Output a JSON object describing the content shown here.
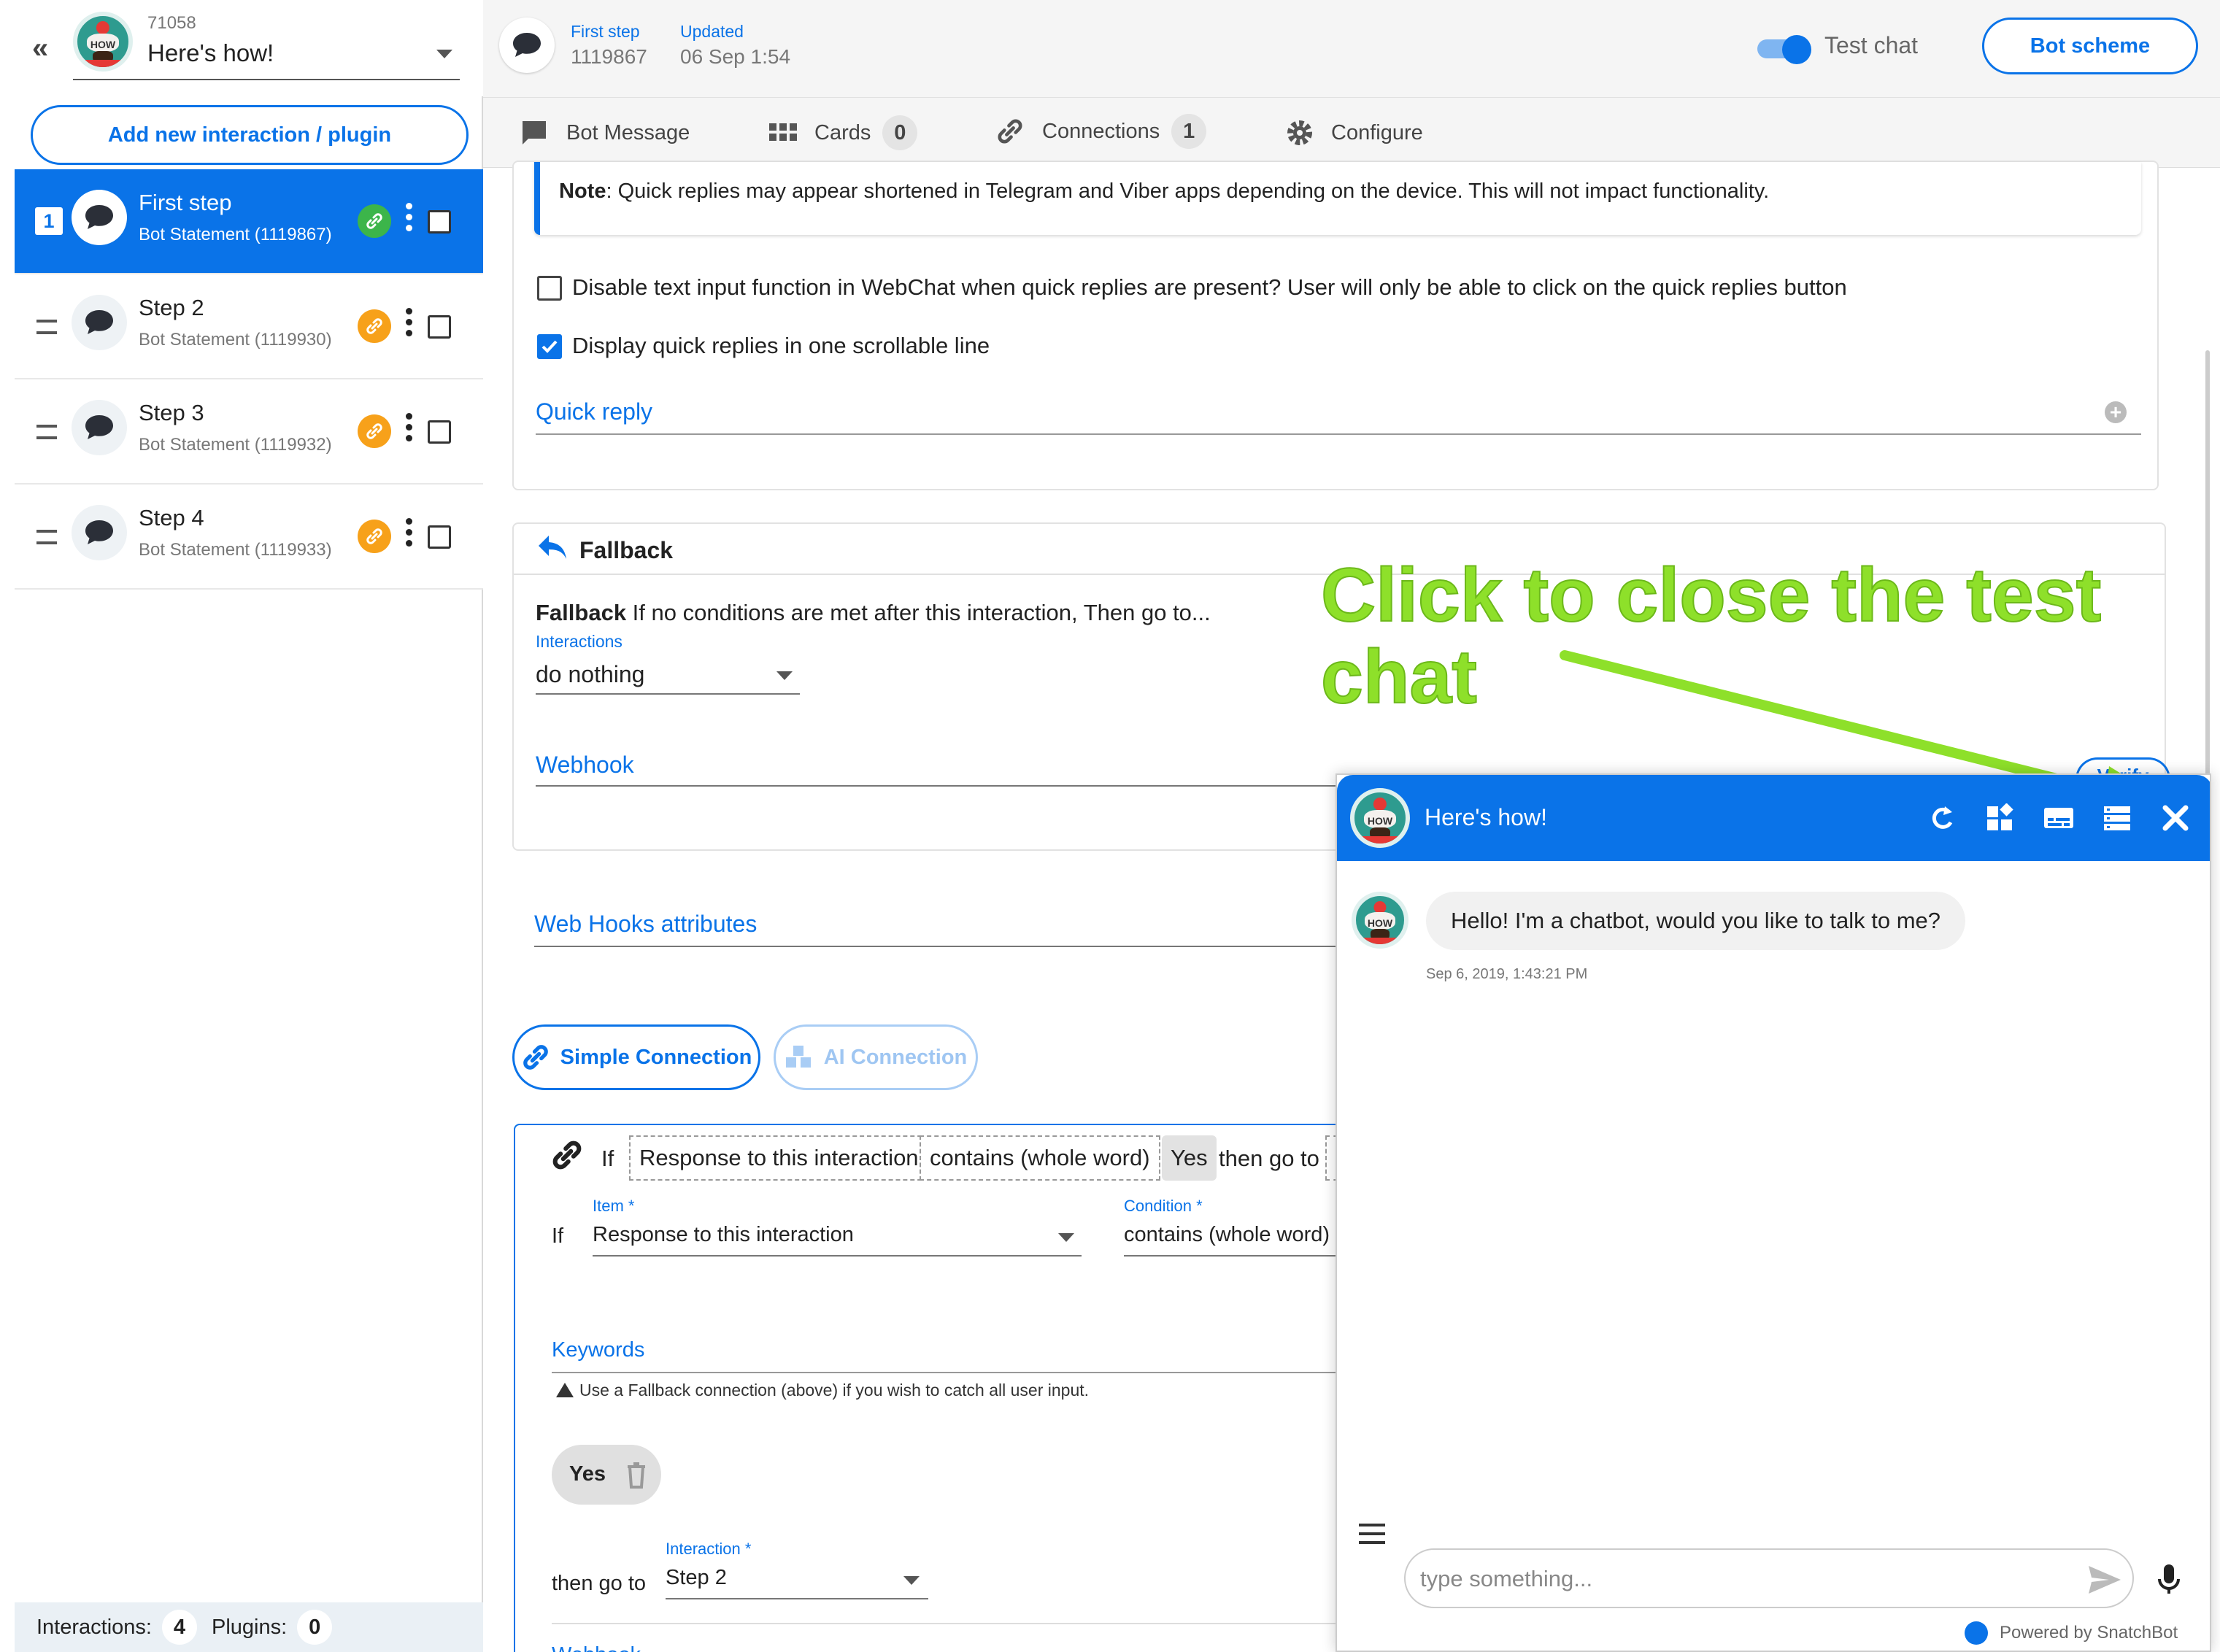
{
  "sidebar": {
    "bot_id": "71058",
    "bot_name": "Here's how!",
    "add_button": "Add new interaction / plugin",
    "items": [
      {
        "index": "1",
        "title": "First step",
        "subtitle": "Bot Statement (1119867)"
      },
      {
        "title": "Step 2",
        "subtitle": "Bot Statement (1119930)"
      },
      {
        "title": "Step 3",
        "subtitle": "Bot Statement (1119932)"
      },
      {
        "title": "Step 4",
        "subtitle": "Bot Statement (1119933)"
      }
    ],
    "footer": {
      "interactions_label": "Interactions:",
      "interactions_count": "4",
      "plugins_label": "Plugins:",
      "plugins_count": "0"
    }
  },
  "header": {
    "step_label": "First step",
    "step_id": "1119867",
    "updated_label": "Updated",
    "updated_value": "06 Sep 1:54",
    "test_chat_label": "Test chat",
    "bot_scheme_button": "Bot scheme"
  },
  "tabs": [
    {
      "label": "Bot Message"
    },
    {
      "label": "Cards",
      "count": "0"
    },
    {
      "label": "Connections",
      "count": "1"
    },
    {
      "label": "Configure"
    }
  ],
  "quick_replies": {
    "note_bold": "Note",
    "note_text": ": Quick replies may appear shortened in Telegram and Viber apps depending on the device. This will not impact functionality.",
    "disable_text_input": "Disable text input function in WebChat when quick replies are present?  User will only be able to click on the quick replies button",
    "scrollable_line": "Display quick replies in one scrollable line",
    "quick_reply_label": "Quick reply"
  },
  "fallback": {
    "title": "Fallback",
    "desc_bold": "Fallback",
    "desc": " If no conditions are met after this interaction, Then go to...",
    "interactions_label": "Interactions",
    "interactions_value": "do nothing",
    "webhook_label": "Webhook",
    "verify_label": "Verify"
  },
  "webhooks_attributes": "Web Hooks attributes",
  "connection_buttons": {
    "simple": "Simple Connection",
    "ai": "AI Connection"
  },
  "connection": {
    "if_label": "If",
    "chip_item": "Response to this interaction",
    "chip_condition": "contains (whole word)",
    "chip_keyword": "Yes",
    "then_go_to": "then go to",
    "item_label": "Item *",
    "item_value": "Response to this interaction",
    "condition_label": "Condition *",
    "condition_value": "contains (whole word)",
    "keywords_label": "Keywords",
    "keywords_hint": "Use a Fallback connection (above) if you wish to catch all user input.",
    "keyword_chip": "Yes",
    "then_go_to_label": "then go to",
    "interaction_label": "Interaction *",
    "interaction_value": "Step 2",
    "webhook_label": "Webhook"
  },
  "chat": {
    "title": "Here's how!",
    "message": "Hello! I'm a chatbot, would you like to talk to me?",
    "timestamp": "Sep 6, 2019, 1:43:21 PM",
    "input_placeholder": "type something...",
    "powered_by": "Powered by SnatchBot"
  },
  "annotation": {
    "text": "Click to close the test chat"
  },
  "colors": {
    "primary": "#0a73e8",
    "link_active": "#3cb54a",
    "link_idle": "#f7a11a",
    "annotation": "#8ee02a"
  }
}
